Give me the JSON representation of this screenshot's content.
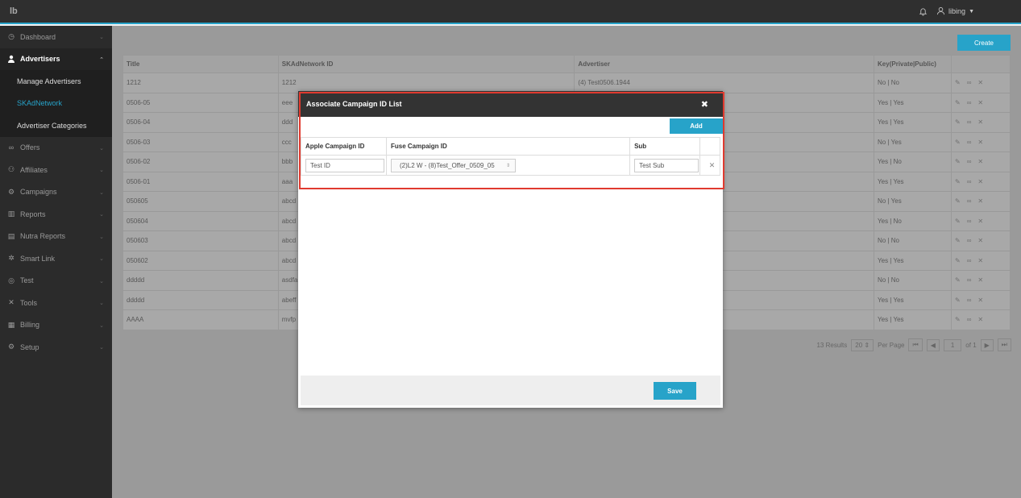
{
  "app": {
    "brand": "lb",
    "user": "libing"
  },
  "sidebar": {
    "items": [
      {
        "label": "Dashboard",
        "icon": "clock"
      },
      {
        "label": "Advertisers",
        "icon": "user",
        "active": true
      },
      {
        "label": "Offers",
        "icon": "link"
      },
      {
        "label": "Affiliates",
        "icon": "users"
      },
      {
        "label": "Campaigns",
        "icon": "gear"
      },
      {
        "label": "Reports",
        "icon": "chart"
      },
      {
        "label": "Nutra Reports",
        "icon": "doc"
      },
      {
        "label": "Smart Link",
        "icon": "share"
      },
      {
        "label": "Test",
        "icon": "target"
      },
      {
        "label": "Tools",
        "icon": "tools"
      },
      {
        "label": "Billing",
        "icon": "billing"
      },
      {
        "label": "Setup",
        "icon": "setup"
      }
    ],
    "sub_items": [
      {
        "label": "Manage Advertisers"
      },
      {
        "label": "SKAdNetwork",
        "current": true
      },
      {
        "label": "Advertiser Categories"
      }
    ]
  },
  "main": {
    "create_label": "Create",
    "columns": [
      "Title",
      "SKAdNetwork ID",
      "Advertiser",
      "Key(Private|Public)",
      ""
    ],
    "rows": [
      {
        "title": "1212",
        "skad": "1212",
        "advertiser": "(4) Test0506.1944",
        "key": "No | No"
      },
      {
        "title": "0506-05",
        "skad": "eee",
        "advertiser": "",
        "key": "Yes | Yes"
      },
      {
        "title": "0506-04",
        "skad": "ddd",
        "advertiser": "",
        "key": "Yes | Yes"
      },
      {
        "title": "0506-03",
        "skad": "ccc",
        "advertiser": "",
        "key": "No | Yes"
      },
      {
        "title": "0506-02",
        "skad": "bbb",
        "advertiser": "",
        "key": "Yes | No"
      },
      {
        "title": "0506-01",
        "skad": "aaa",
        "advertiser": "",
        "key": "Yes | Yes"
      },
      {
        "title": "050605",
        "skad": "abcd",
        "advertiser": "",
        "key": "No | Yes"
      },
      {
        "title": "050604",
        "skad": "abcd",
        "advertiser": "",
        "key": "Yes | No"
      },
      {
        "title": "050603",
        "skad": "abcd",
        "advertiser": "",
        "key": "No | No"
      },
      {
        "title": "050602",
        "skad": "abcd",
        "advertiser": "",
        "key": "Yes | Yes"
      },
      {
        "title": "ddddd",
        "skad": "asdfa",
        "advertiser": "",
        "key": "No | No"
      },
      {
        "title": "ddddd",
        "skad": "abeff",
        "advertiser": "",
        "key": "Yes | Yes"
      },
      {
        "title": "AAAA",
        "skad": "mvfp",
        "advertiser": "",
        "key": "Yes | Yes"
      }
    ],
    "pager": {
      "results": "13 Results",
      "per_page_value": "20",
      "per_page_label": "Per Page",
      "page": "1",
      "of": "of 1"
    }
  },
  "modal": {
    "title": "Associate Campaign ID List",
    "add_label": "Add",
    "columns": [
      "Apple Campaign ID",
      "Fuse Campaign ID",
      "Sub",
      ""
    ],
    "row": {
      "apple_placeholder": "Test ID",
      "fuse_selected": "(2)L2 W - (8)Test_Offer_0509_05",
      "sub_placeholder": "Test Sub"
    },
    "save_label": "Save"
  },
  "colors": {
    "accent": "#27a3c9",
    "highlight": "#e03a2f",
    "topbar": "#2f2f2f",
    "sidebar": "#2b2b2b"
  }
}
